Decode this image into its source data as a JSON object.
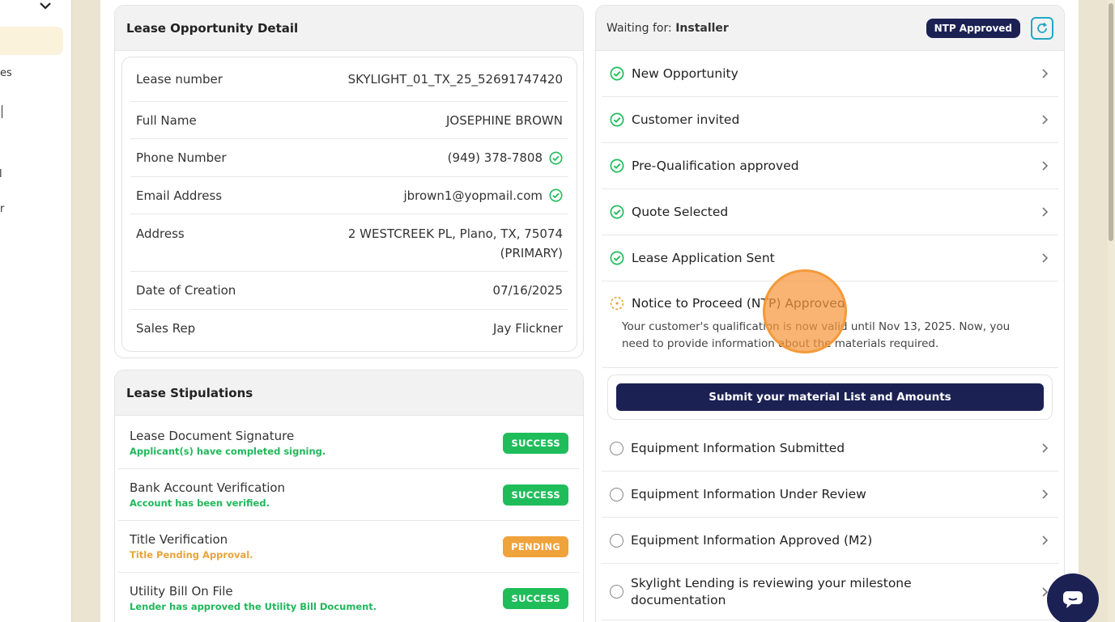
{
  "sidebar": {
    "fragments": [
      "es",
      "l",
      "r"
    ],
    "icons": [
      "chevron-down-icon"
    ]
  },
  "lease_detail": {
    "title": "Lease Opportunity Detail",
    "rows": [
      {
        "label": "Lease number",
        "value": "SKYLIGHT_01_TX_25_52691747420",
        "verified": false
      },
      {
        "label": "Full Name",
        "value": "JOSEPHINE BROWN",
        "verified": false
      },
      {
        "label": "Phone Number",
        "value": "(949) 378-7808",
        "verified": true
      },
      {
        "label": "Email Address",
        "value": "jbrown1@yopmail.com",
        "verified": true
      },
      {
        "label": "Address",
        "value": "2 WESTCREEK PL, Plano, TX, 75074",
        "value2": "(PRIMARY)",
        "verified": false
      },
      {
        "label": "Date of Creation",
        "value": "07/16/2025",
        "verified": false
      },
      {
        "label": "Sales Rep",
        "value": "Jay Flickner",
        "verified": false
      }
    ]
  },
  "stipulations": {
    "title": "Lease Stipulations",
    "items": [
      {
        "title": "Lease Document Signature",
        "sub": "Applicant(s) have completed signing.",
        "status": "SUCCESS"
      },
      {
        "title": "Bank Account Verification",
        "sub": "Account has been verified.",
        "status": "SUCCESS"
      },
      {
        "title": "Title Verification",
        "sub": "Title Pending Approval.",
        "status": "PENDING"
      },
      {
        "title": "Utility Bill On File",
        "sub": "Lender has approved the Utility Bill Document.",
        "status": "SUCCESS"
      }
    ]
  },
  "timeline": {
    "waiting_prefix": "Waiting for:",
    "waiting_for": "Installer",
    "status_badge": "NTP Approved",
    "completed_steps": [
      "New Opportunity",
      "Customer invited",
      "Pre-Qualification approved",
      "Quote Selected",
      "Lease Application Sent"
    ],
    "current_step": {
      "title": "Notice to Proceed (NTP) Approved",
      "description": "Your customer's qualification is now valid until Nov 13, 2025. Now, you need to provide information about the materials required.",
      "action_label": "Submit your material List and Amounts"
    },
    "pending_steps": [
      "Equipment Information Submitted",
      "Equipment Information Under Review",
      "Equipment Information Approved (M2)",
      "Skylight Lending is reviewing your milestone documentation"
    ]
  },
  "colors": {
    "navy": "#1c2154",
    "success": "#1fbd5a",
    "pending": "#f0a23b",
    "background": "#ebe4d1"
  }
}
